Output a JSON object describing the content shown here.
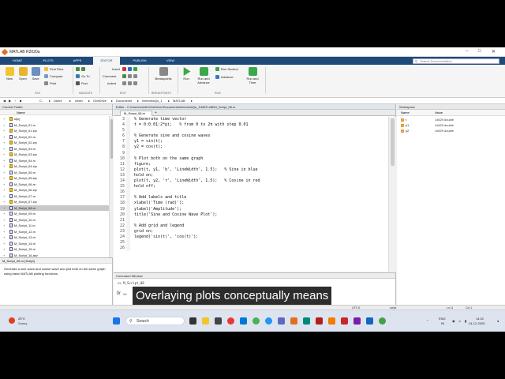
{
  "app": {
    "title": "MATLAB R2020a"
  },
  "ribbon_tabs": [
    {
      "label": "HOME"
    },
    {
      "label": "PLOTS"
    },
    {
      "label": "APPS"
    },
    {
      "label": "EDITOR"
    },
    {
      "label": "PUBLISH"
    },
    {
      "label": "VIEW"
    }
  ],
  "search_placeholder": "Search Documentation",
  "ribbon": {
    "new": "New",
    "open": "Open",
    "save": "Save",
    "find_files": "Find Files",
    "compare": "Compare",
    "print": "Print",
    "go_to": "Go To",
    "find": "Find",
    "insert": "Insert",
    "comment": "Comment",
    "indent": "Indent",
    "breakpoints": "Breakpoints",
    "run": "Run",
    "run_advance": "Run and Advance",
    "run_section": "Run Section",
    "advance": "Advance",
    "run_time": "Run and Time",
    "sections": {
      "file": "FILE",
      "navigate": "NAVIGATE",
      "edit": "EDIT",
      "breakpoints": "BREAKPOINTS",
      "run": "RUN"
    }
  },
  "address": {
    "parts": [
      "C:",
      "Users",
      "cheth",
      "OneDrive",
      "Documents",
      "InterviewQs_1",
      "MATLAB"
    ]
  },
  "current_folder": {
    "title": "Current Folder",
    "col_name": "Name",
    "files": [
      {
        "name": "slprj",
        "kind": "folder"
      },
      {
        "name": "M_Script_01.m",
        "kind": "m"
      },
      {
        "name": "M_Script_01.zip",
        "kind": "zip"
      },
      {
        "name": "M_Script_02.m",
        "kind": "m"
      },
      {
        "name": "M_Script_02.zip",
        "kind": "zip"
      },
      {
        "name": "M_Script_03.m",
        "kind": "m"
      },
      {
        "name": "M_Script_03.zip",
        "kind": "zip"
      },
      {
        "name": "M_Script_04.m",
        "kind": "m"
      },
      {
        "name": "M_Script_04.zip",
        "kind": "zip"
      },
      {
        "name": "M_Script_05.m",
        "kind": "m"
      },
      {
        "name": "M_Script_05.zip",
        "kind": "zip"
      },
      {
        "name": "M_Script_06.m",
        "kind": "m"
      },
      {
        "name": "M_Script_06.zip",
        "kind": "zip"
      },
      {
        "name": "M_Script_07.m",
        "kind": "m"
      },
      {
        "name": "M_Script_07.zip",
        "kind": "zip"
      },
      {
        "name": "M_Script_08.m",
        "kind": "m",
        "selected": true
      },
      {
        "name": "M_Script_09.m",
        "kind": "m"
      },
      {
        "name": "M_Script_10.m",
        "kind": "m"
      },
      {
        "name": "M_Script_11.m",
        "kind": "m"
      },
      {
        "name": "M_Script_12.m",
        "kind": "m"
      },
      {
        "name": "M_Script_13.m",
        "kind": "m"
      },
      {
        "name": "M_Script_14.m",
        "kind": "m"
      },
      {
        "name": "M_Script_15.m",
        "kind": "m"
      },
      {
        "name": "M_Script_16.asv",
        "kind": "m"
      }
    ]
  },
  "details": {
    "header": "M_Script_08.m (Script)",
    "text": "Generate a sine wave and cosine wave and plot both on the same graph using basic MATLAB plotting functions."
  },
  "editor": {
    "title": "Editor - C:\\Users\\cheth\\OneDrive\\Documents\\InterviewQs_1\\MATLAB\\M_Script_08.m",
    "tab": "M_Script_08.m",
    "lines": [
      {
        "n": "3",
        "text": "% Generate time vector",
        "cls": "cm"
      },
      {
        "n": "4",
        "text": "t = 0:0.01:2*pi;   % from 0 to 2π with step 0.01",
        "cls": ""
      },
      {
        "n": "5",
        "text": "",
        "cls": ""
      },
      {
        "n": "6",
        "text": "% Generate sine and cosine waves",
        "cls": "cm"
      },
      {
        "n": "7",
        "text": "y1 = sin(t);",
        "cls": ""
      },
      {
        "n": "8",
        "text": "y2 = cos(t);",
        "cls": ""
      },
      {
        "n": "9",
        "text": "",
        "cls": ""
      },
      {
        "n": "10",
        "text": "% Plot both on the same graph",
        "cls": "cm"
      },
      {
        "n": "11",
        "text": "figure;",
        "cls": ""
      },
      {
        "n": "12",
        "text": "plot(t, y1, 'b', 'LineWidth', 1.5);   % Sine in blue",
        "cls": ""
      },
      {
        "n": "13",
        "text": "hold on;",
        "cls": ""
      },
      {
        "n": "14",
        "text": "plot(t, y2, 'r', 'LineWidth', 1.5);   % Cosine in red",
        "cls": ""
      },
      {
        "n": "15",
        "text": "hold off;",
        "cls": ""
      },
      {
        "n": "16",
        "text": "",
        "cls": ""
      },
      {
        "n": "17",
        "text": "% Add labels and title",
        "cls": "cm"
      },
      {
        "n": "18",
        "text": "xlabel('Time (rad)');",
        "cls": ""
      },
      {
        "n": "19",
        "text": "ylabel('Amplitude');",
        "cls": ""
      },
      {
        "n": "20",
        "text": "title('Sine and Cosine Wave Plot');",
        "cls": ""
      },
      {
        "n": "21",
        "text": "",
        "cls": ""
      },
      {
        "n": "22",
        "text": "% Add grid and legend",
        "cls": "cm"
      },
      {
        "n": "23",
        "text": "grid on;",
        "cls": ""
      },
      {
        "n": "24",
        "text": "legend('sin(t)', 'cos(t)');",
        "cls": ""
      },
      {
        "n": "25",
        "text": "",
        "cls": ""
      },
      {
        "n": "26",
        "text": "",
        "cls": ""
      }
    ]
  },
  "workspace": {
    "title": "Workspace",
    "col_name": "Name",
    "col_value": "Value",
    "vars": [
      {
        "name": "t",
        "value": "1x629 double"
      },
      {
        "name": "y1",
        "value": "1x629 double"
      },
      {
        "name": "y2",
        "value": "1x629 double"
      }
    ]
  },
  "command_window": {
    "title": "Command Window",
    "history": ">> M_Script_08",
    "fx": "fx",
    "prompt": ">>"
  },
  "status": {
    "encoding": "UTF-8",
    "type": "script",
    "ln": "Ln  11",
    "col": "Col  1"
  },
  "caption": "Overlaying plots conceptually means",
  "taskbar": {
    "temp": "25°C",
    "weather": "Sunny",
    "search": "Search",
    "lang": "ENG",
    "region": "IN",
    "time": "14:02",
    "date": "24-12-2025"
  },
  "colors": {
    "ribbon_blue": "#1e4a7a",
    "caption_bg": "#2d2d2d",
    "comment": "#228b22"
  }
}
